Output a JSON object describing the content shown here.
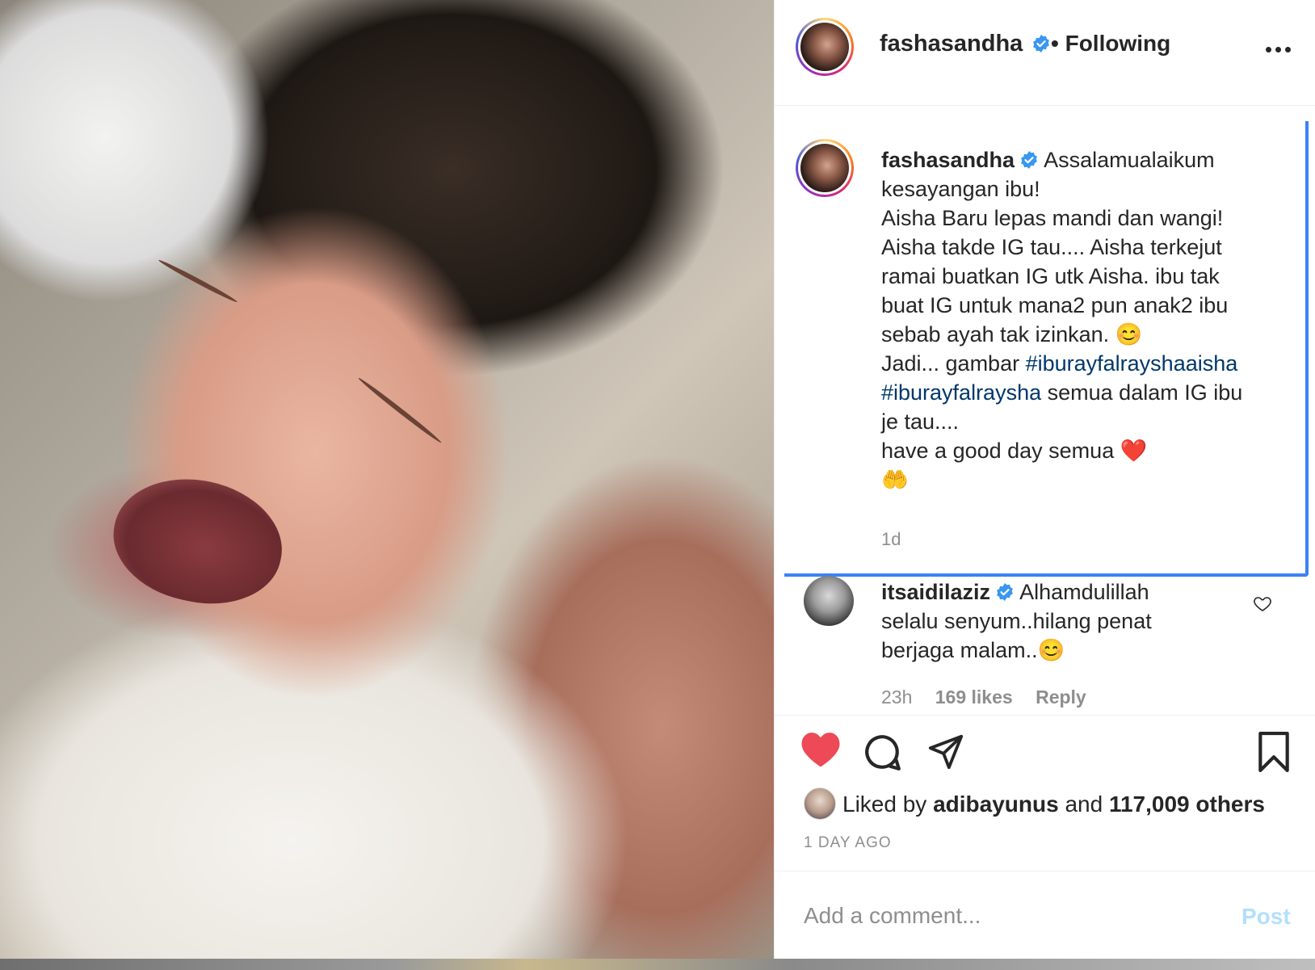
{
  "post": {
    "username": "fashasandha",
    "follow_status": "Following",
    "separator": "•",
    "caption_lines": [
      "Assalamualaikum",
      "kesayangan ibu!",
      "Aisha Baru lepas mandi dan wangi!",
      "Aisha takde IG tau.... Aisha terkejut",
      "ramai buatkan IG utk Aisha. ibu tak",
      "buat IG untuk mana2 pun anak2 ibu",
      "sebab ayah tak izinkan. 😊",
      "Jadi... gambar",
      "#iburayfalraysha",
      "semua dalam IG ibu",
      "je tau....",
      "have a good day semua ❤️",
      "🤲"
    ],
    "hashtags": [
      "#iburayfalrayshaaisha",
      "#iburayfalraysha"
    ],
    "caption_time": "1d",
    "likes_prefix": "Liked by",
    "liked_by_user": "adibayunus",
    "likes_conjunction": "and",
    "likes_others": "117,009 others",
    "time_ago": "1 DAY AGO"
  },
  "comment": {
    "username": "itsaidilaziz",
    "text_first": "Alhamdulillah",
    "text_rest": "selalu senyum..hilang penat\nberjaga malam..😊",
    "time": "23h",
    "likes": "169 likes",
    "reply_label": "Reply"
  },
  "comment_box": {
    "placeholder": "Add a comment...",
    "post_label": "Post"
  },
  "colors": {
    "accent": "#3b82f6",
    "like_red": "#ed4956",
    "hashtag": "#00376b",
    "post_disabled": "#b2dffc",
    "verified_blue": "#3897f0"
  },
  "icons": [
    "verified-icon",
    "more-options-icon",
    "heart-icon",
    "comment-icon",
    "share-icon",
    "bookmark-icon",
    "comment-like-icon"
  ]
}
